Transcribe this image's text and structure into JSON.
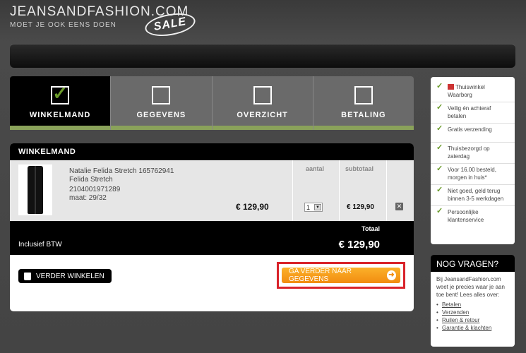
{
  "header": {
    "logo_main": "JEANSANDFASHION.COM",
    "logo_sub": "MOET JE OOK EENS DOEN",
    "logo_badge": "SALE"
  },
  "steps": [
    {
      "label": "WINKELMAND",
      "active": true,
      "checked": true
    },
    {
      "label": "GEGEVENS",
      "active": false,
      "checked": false
    },
    {
      "label": "OVERZICHT",
      "active": false,
      "checked": false
    },
    {
      "label": "BETALING",
      "active": false,
      "checked": false
    }
  ],
  "cart": {
    "title": "WINKELMAND",
    "col_qty": "aantal",
    "col_subtotal": "subtotaal",
    "item": {
      "name_line1": "Natalie Felida Stretch 165762941",
      "name_line2": "Felida Stretch",
      "sku": "2104001971289",
      "size": "maat: 29/32",
      "price": "€ 129,90",
      "qty": "1",
      "subtotal": "€ 129,90"
    },
    "total_label": "Totaal",
    "incl_vat": "Inclusief BTW",
    "total_value": "€ 129,90",
    "btn_back": "VERDER WINKELEN",
    "btn_next": "GA VERDER NAAR GEGEVENS"
  },
  "usp": [
    {
      "text": "Thuiswinkel Waarborg",
      "icon": "home-icon"
    },
    {
      "text": "Veilig én achteraf betalen"
    },
    {
      "text": "Gratis verzending"
    },
    {
      "text": "Thuisbezorgd op zaterdag"
    },
    {
      "text": "Voor 16.00 besteld, morgen in huis*"
    },
    {
      "text": "Niet goed, geld terug binnen 3-5 werkdagen"
    },
    {
      "text": "Persoonlijke klantenservice"
    }
  ],
  "faq": {
    "title": "NOG VRAGEN?",
    "intro": "Bij JeansandFashion.com weet je precies waar je aan toe bent! Lees alles over:",
    "links": [
      "Betalen",
      "Verzenden",
      "Ruilen & retour",
      "Garantie & klachten"
    ]
  },
  "colors": {
    "accent": "#8aa25a",
    "cta": "#f28c10",
    "highlight": "#d9232a"
  }
}
